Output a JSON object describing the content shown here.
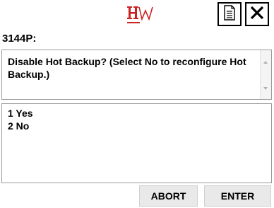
{
  "header": {
    "logo_icon": "hw-logo-icon",
    "logo_color": "#cc2222",
    "buttons": [
      {
        "icon": "document-icon"
      },
      {
        "icon": "close-icon"
      }
    ]
  },
  "device": {
    "title": "3144P:"
  },
  "prompt": {
    "text": "Disable Hot Backup? (Select No to reconfigure Hot Backup.)"
  },
  "options": [
    {
      "label": "1 Yes"
    },
    {
      "label": "2 No"
    }
  ],
  "actions": {
    "abort_label": "ABORT",
    "enter_label": "ENTER"
  }
}
